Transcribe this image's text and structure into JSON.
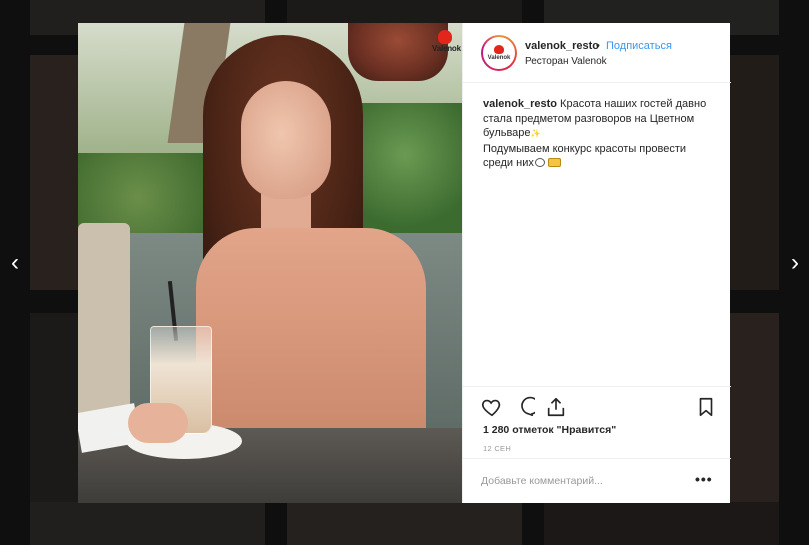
{
  "post": {
    "username": "valenok_resto",
    "separator": "•",
    "follow_label": "Подписаться",
    "location": "Ресторан Valenok",
    "avatar_label": "Valenok",
    "photo_logo": "Valenok",
    "caption_user": "valenok_resto",
    "caption_line1": "Красота наших гостей давно стала предметом разговоров на Цветном бульваре",
    "caption_line2": "Подумываем конкурс красоты провести среди них",
    "likes": "1 280 отметок \"Нравится\"",
    "date": "12 СЕН",
    "comment_placeholder": "Добавьте комментарий...",
    "more_label": "•••"
  },
  "icons": {
    "like": "heart-icon",
    "comment": "comment-icon",
    "share": "share-icon",
    "save": "bookmark-icon",
    "prev": "chevron-left-icon",
    "next": "chevron-right-icon"
  },
  "nav": {
    "prev": "‹",
    "next": "›"
  },
  "colors": {
    "link": "#3897f0",
    "text": "#262626",
    "muted": "#999999",
    "brand": "#e2261c"
  }
}
